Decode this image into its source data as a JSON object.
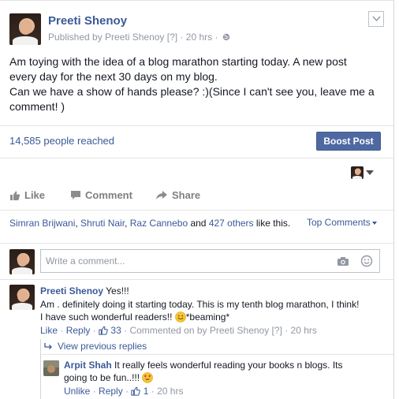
{
  "post": {
    "author": "Preeti Shenoy",
    "meta": "Published by Preeti Shenoy [?] · 20 hrs ·",
    "text_lines": [
      "Am toying with the idea of a blog marathon starting today. A new post",
      "every day for the next 30 days on my blog.",
      "Can we have a show of hands please? :)(Since I can't see you, leave me a",
      "comment! )"
    ],
    "reach": "14,585 people reached",
    "boost_label": "Boost Post"
  },
  "actions": {
    "like": "Like",
    "comment": "Comment",
    "share": "Share"
  },
  "likes": {
    "names": [
      "Simran Brijwani",
      "Shruti Nair",
      "Raz Cannebo"
    ],
    "sep1": ", ",
    "sep2": ", ",
    "and_text": " and ",
    "others": "427 others",
    "like_text": " like this."
  },
  "top_comments_label": "Top Comments",
  "comment_input": {
    "placeholder": "Write a comment..."
  },
  "comments": [
    {
      "author": "Preeti Shenoy",
      "text_first": " Yes!!!",
      "body_line1": "Am . definitely doing it starting today. This is my tenth blog marathon, I think!",
      "body_line2_a": "I have such wonderful readers!! ",
      "body_line2_b": "*beaming*",
      "like": "Like",
      "reply": "Reply",
      "like_count": "33",
      "meta": "· Commented on by Preeti Shenoy [?] · 20 hrs"
    }
  ],
  "view_previous": "View previous replies",
  "reply": {
    "author": "Arpit Shah",
    "text_line1": " It really feels wonderful reading your books n blogs. Its",
    "text_line2": "going to be fun..!!! ",
    "unlike": "Unlike",
    "reply": "Reply",
    "like_count": "1",
    "time": "· 20 hrs"
  },
  "colors": {
    "link": "#3b5998",
    "boost_bg": "#4e69a2",
    "muted": "#9197a3",
    "text": "#141823"
  }
}
